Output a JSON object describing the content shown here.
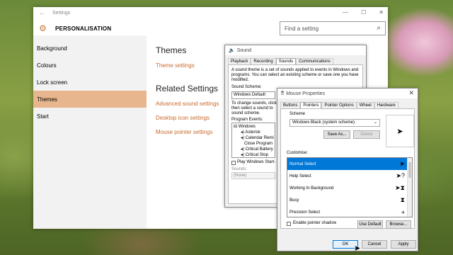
{
  "settings": {
    "window_title": "Settings",
    "app_name": "PERSONALISATION",
    "search_placeholder": "Find a setting",
    "nav": [
      "Background",
      "Colours",
      "Lock screen",
      "Themes",
      "Start"
    ],
    "selected_nav": "Themes",
    "themes_heading": "Themes",
    "themes_link": "Theme settings",
    "related_heading": "Related Settings",
    "related_links": [
      "Advanced sound settings",
      "Desktop icon settings",
      "Mouse pointer settings"
    ],
    "accent": "#c86a2d"
  },
  "sound": {
    "title": "Sound",
    "tabs": [
      "Playback",
      "Recording",
      "Sounds",
      "Communications"
    ],
    "selected_tab": "Sounds",
    "description": "A sound theme is a set of sounds applied to events in Windows and programs. You can select an existing scheme or save one you have modified.",
    "scheme_label": "Sound Scheme:",
    "scheme_value": "Windows Default",
    "change_text_1": "To change sounds, click",
    "change_text_2": "then select a sound to",
    "change_text_3": "sound scheme.",
    "events_label": "Program Events:",
    "events": [
      "Windows",
      "Asterisk",
      "Calendar Remi",
      "Close Program",
      "Critical Battery",
      "Critical Stop"
    ],
    "startup_checkbox": "Play Windows Start-",
    "sounds_label": "Sounds:",
    "sounds_value": "(None)"
  },
  "mouse": {
    "title": "Mouse Properties",
    "tabs": [
      "Buttons",
      "Pointers",
      "Pointer Options",
      "Wheel",
      "Hardware"
    ],
    "selected_tab": "Pointers",
    "scheme_label": "Scheme",
    "scheme_value": "Windows Black (system scheme)",
    "save_as": "Save As...",
    "delete": "Delete",
    "customise_label": "Customise:",
    "pointers": [
      {
        "name": "Normal Select",
        "icon": "arrow-pointer"
      },
      {
        "name": "Help Select",
        "icon": "help-pointer"
      },
      {
        "name": "Working In Background",
        "icon": "busy-arrow-pointer"
      },
      {
        "name": "Busy",
        "icon": "hourglass-pointer"
      },
      {
        "name": "Precision Select",
        "icon": "crosshair-pointer"
      }
    ],
    "shadow_checkbox": "Enable pointer shadow",
    "use_default": "Use Default",
    "browse": "Browse...",
    "ok": "OK",
    "cancel": "Cancel",
    "apply": "Apply",
    "selection_color": "#0078d7"
  }
}
